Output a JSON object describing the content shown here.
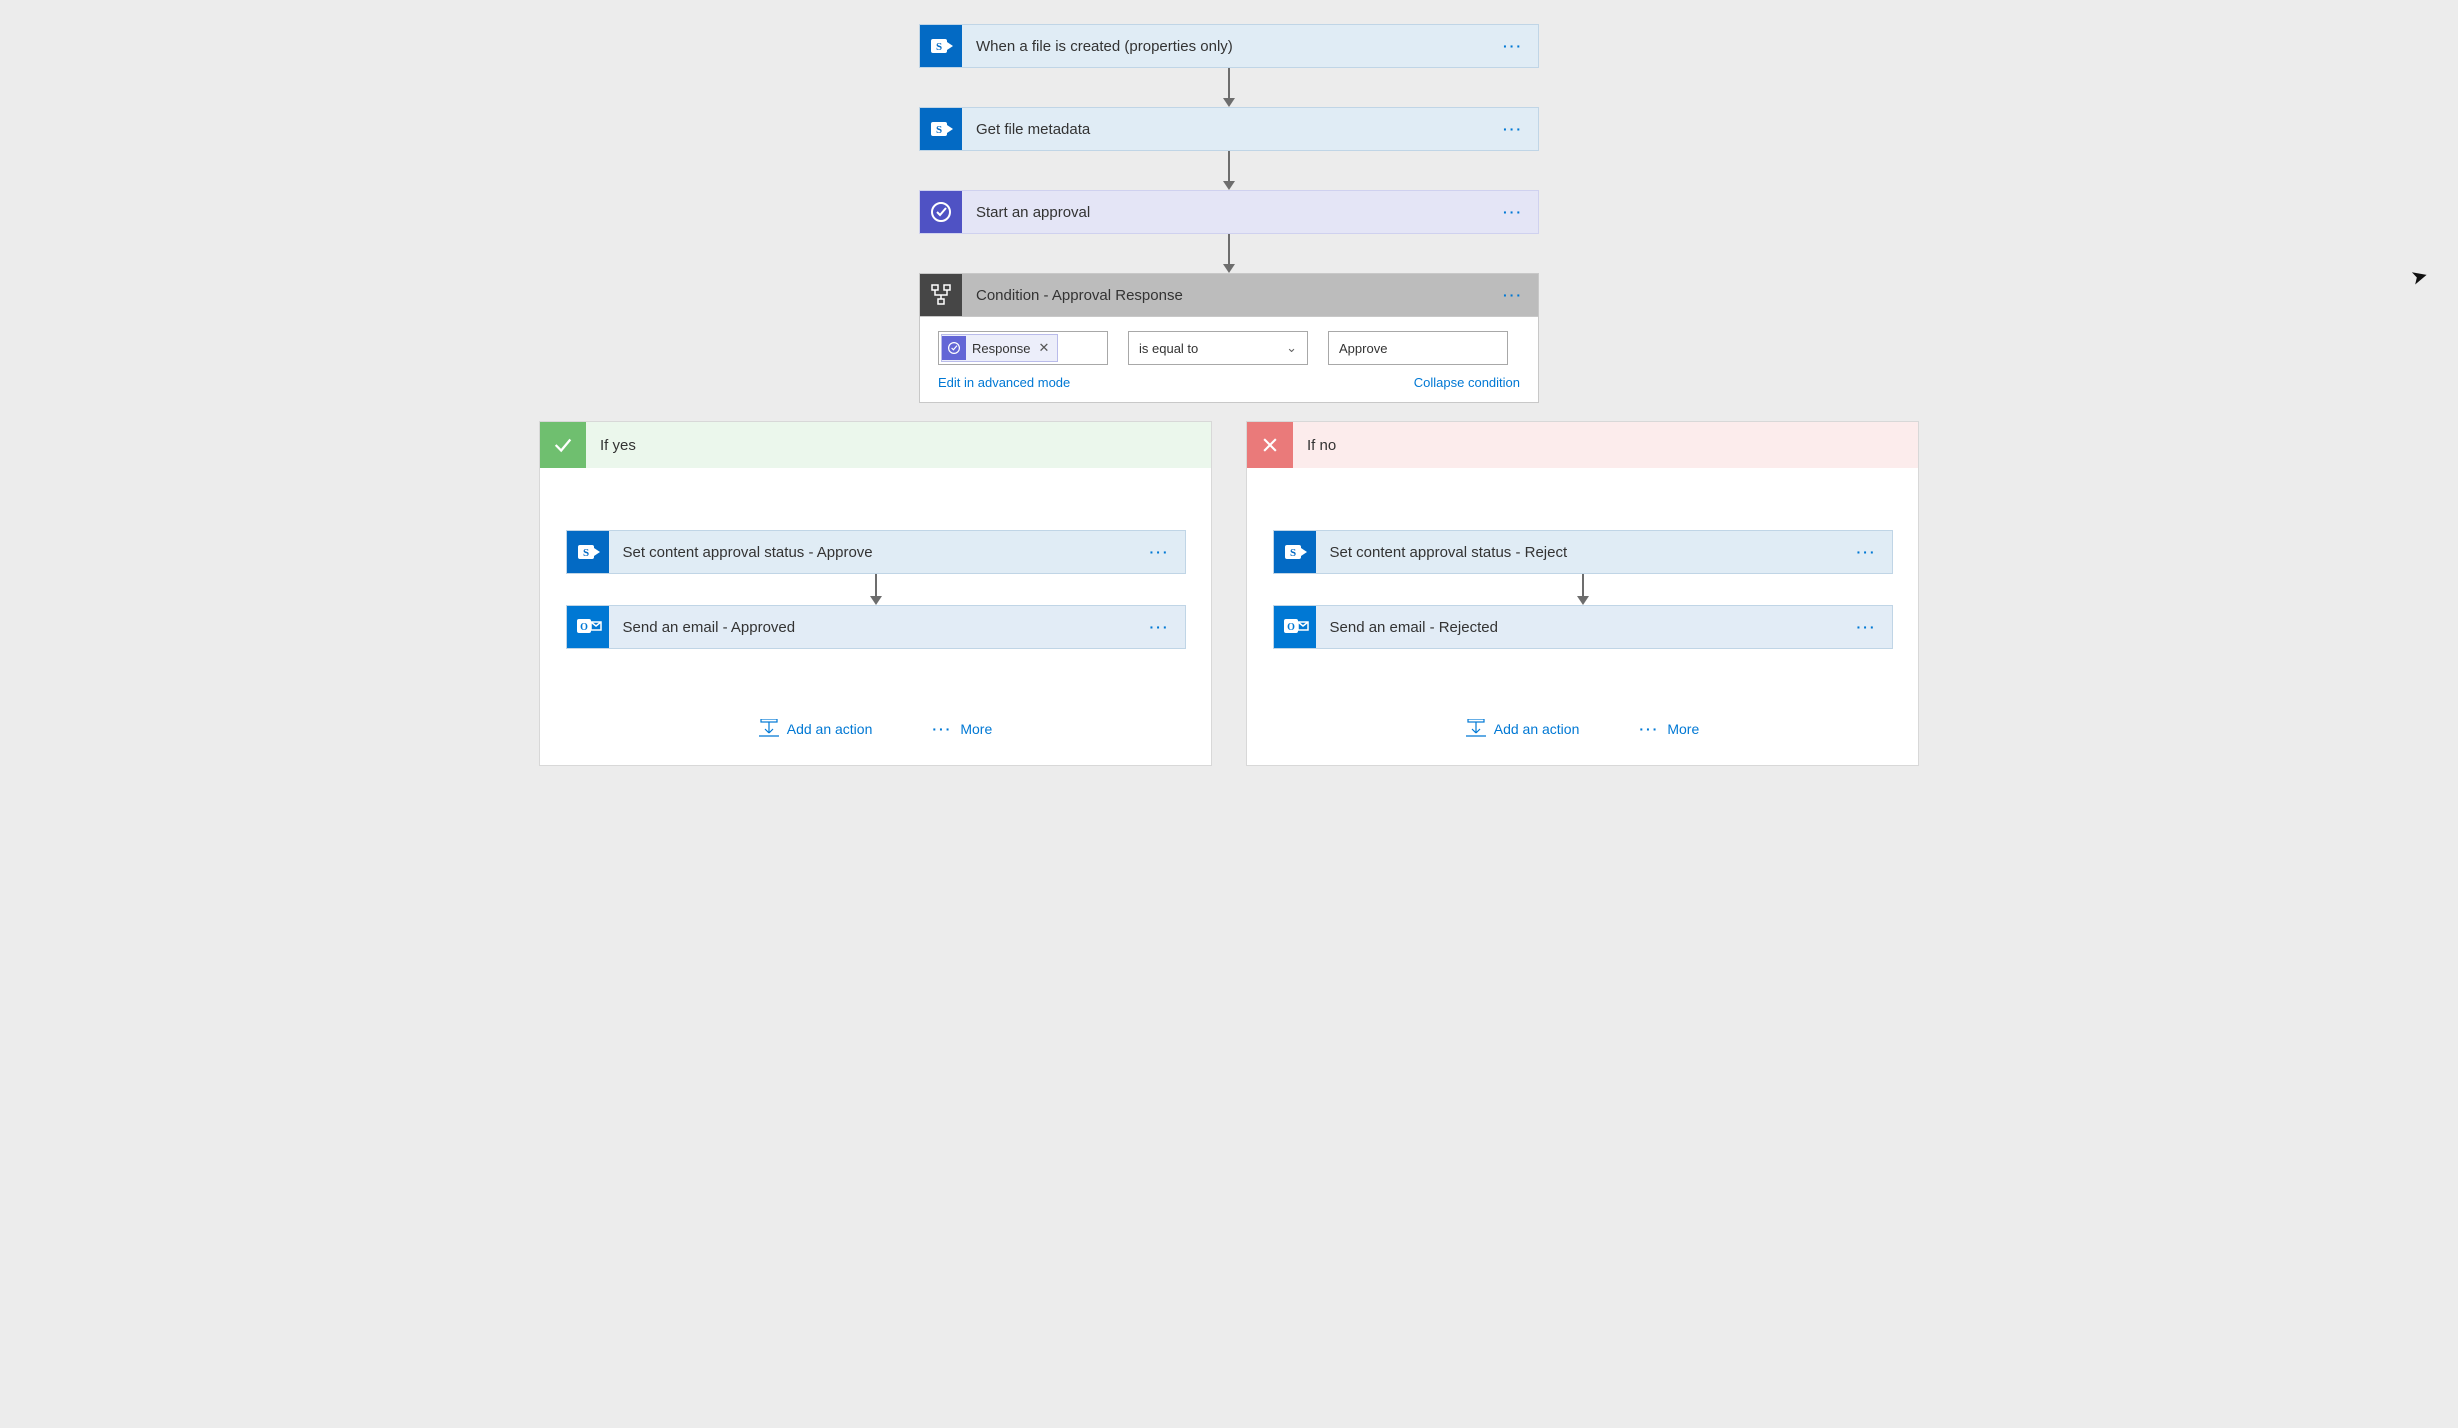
{
  "steps": {
    "trigger": {
      "title": "When a file is created (properties only)"
    },
    "getmeta": {
      "title": "Get file metadata"
    },
    "approval": {
      "title": "Start an approval"
    },
    "condition": {
      "title": "Condition - Approval Response",
      "token": "Response",
      "operator": "is equal to",
      "value": "Approve",
      "edit_link": "Edit in advanced mode",
      "collapse_link": "Collapse condition"
    }
  },
  "branches": {
    "yes": {
      "label": "If yes",
      "steps": [
        {
          "title": "Set content approval status - Approve",
          "icon": "sp"
        },
        {
          "title": "Send an email - Approved",
          "icon": "out"
        }
      ]
    },
    "no": {
      "label": "If no",
      "steps": [
        {
          "title": "Set content approval status - Reject",
          "icon": "sp"
        },
        {
          "title": "Send an email - Rejected",
          "icon": "out"
        }
      ]
    }
  },
  "footer": {
    "add_action": "Add an action",
    "more": "More"
  }
}
